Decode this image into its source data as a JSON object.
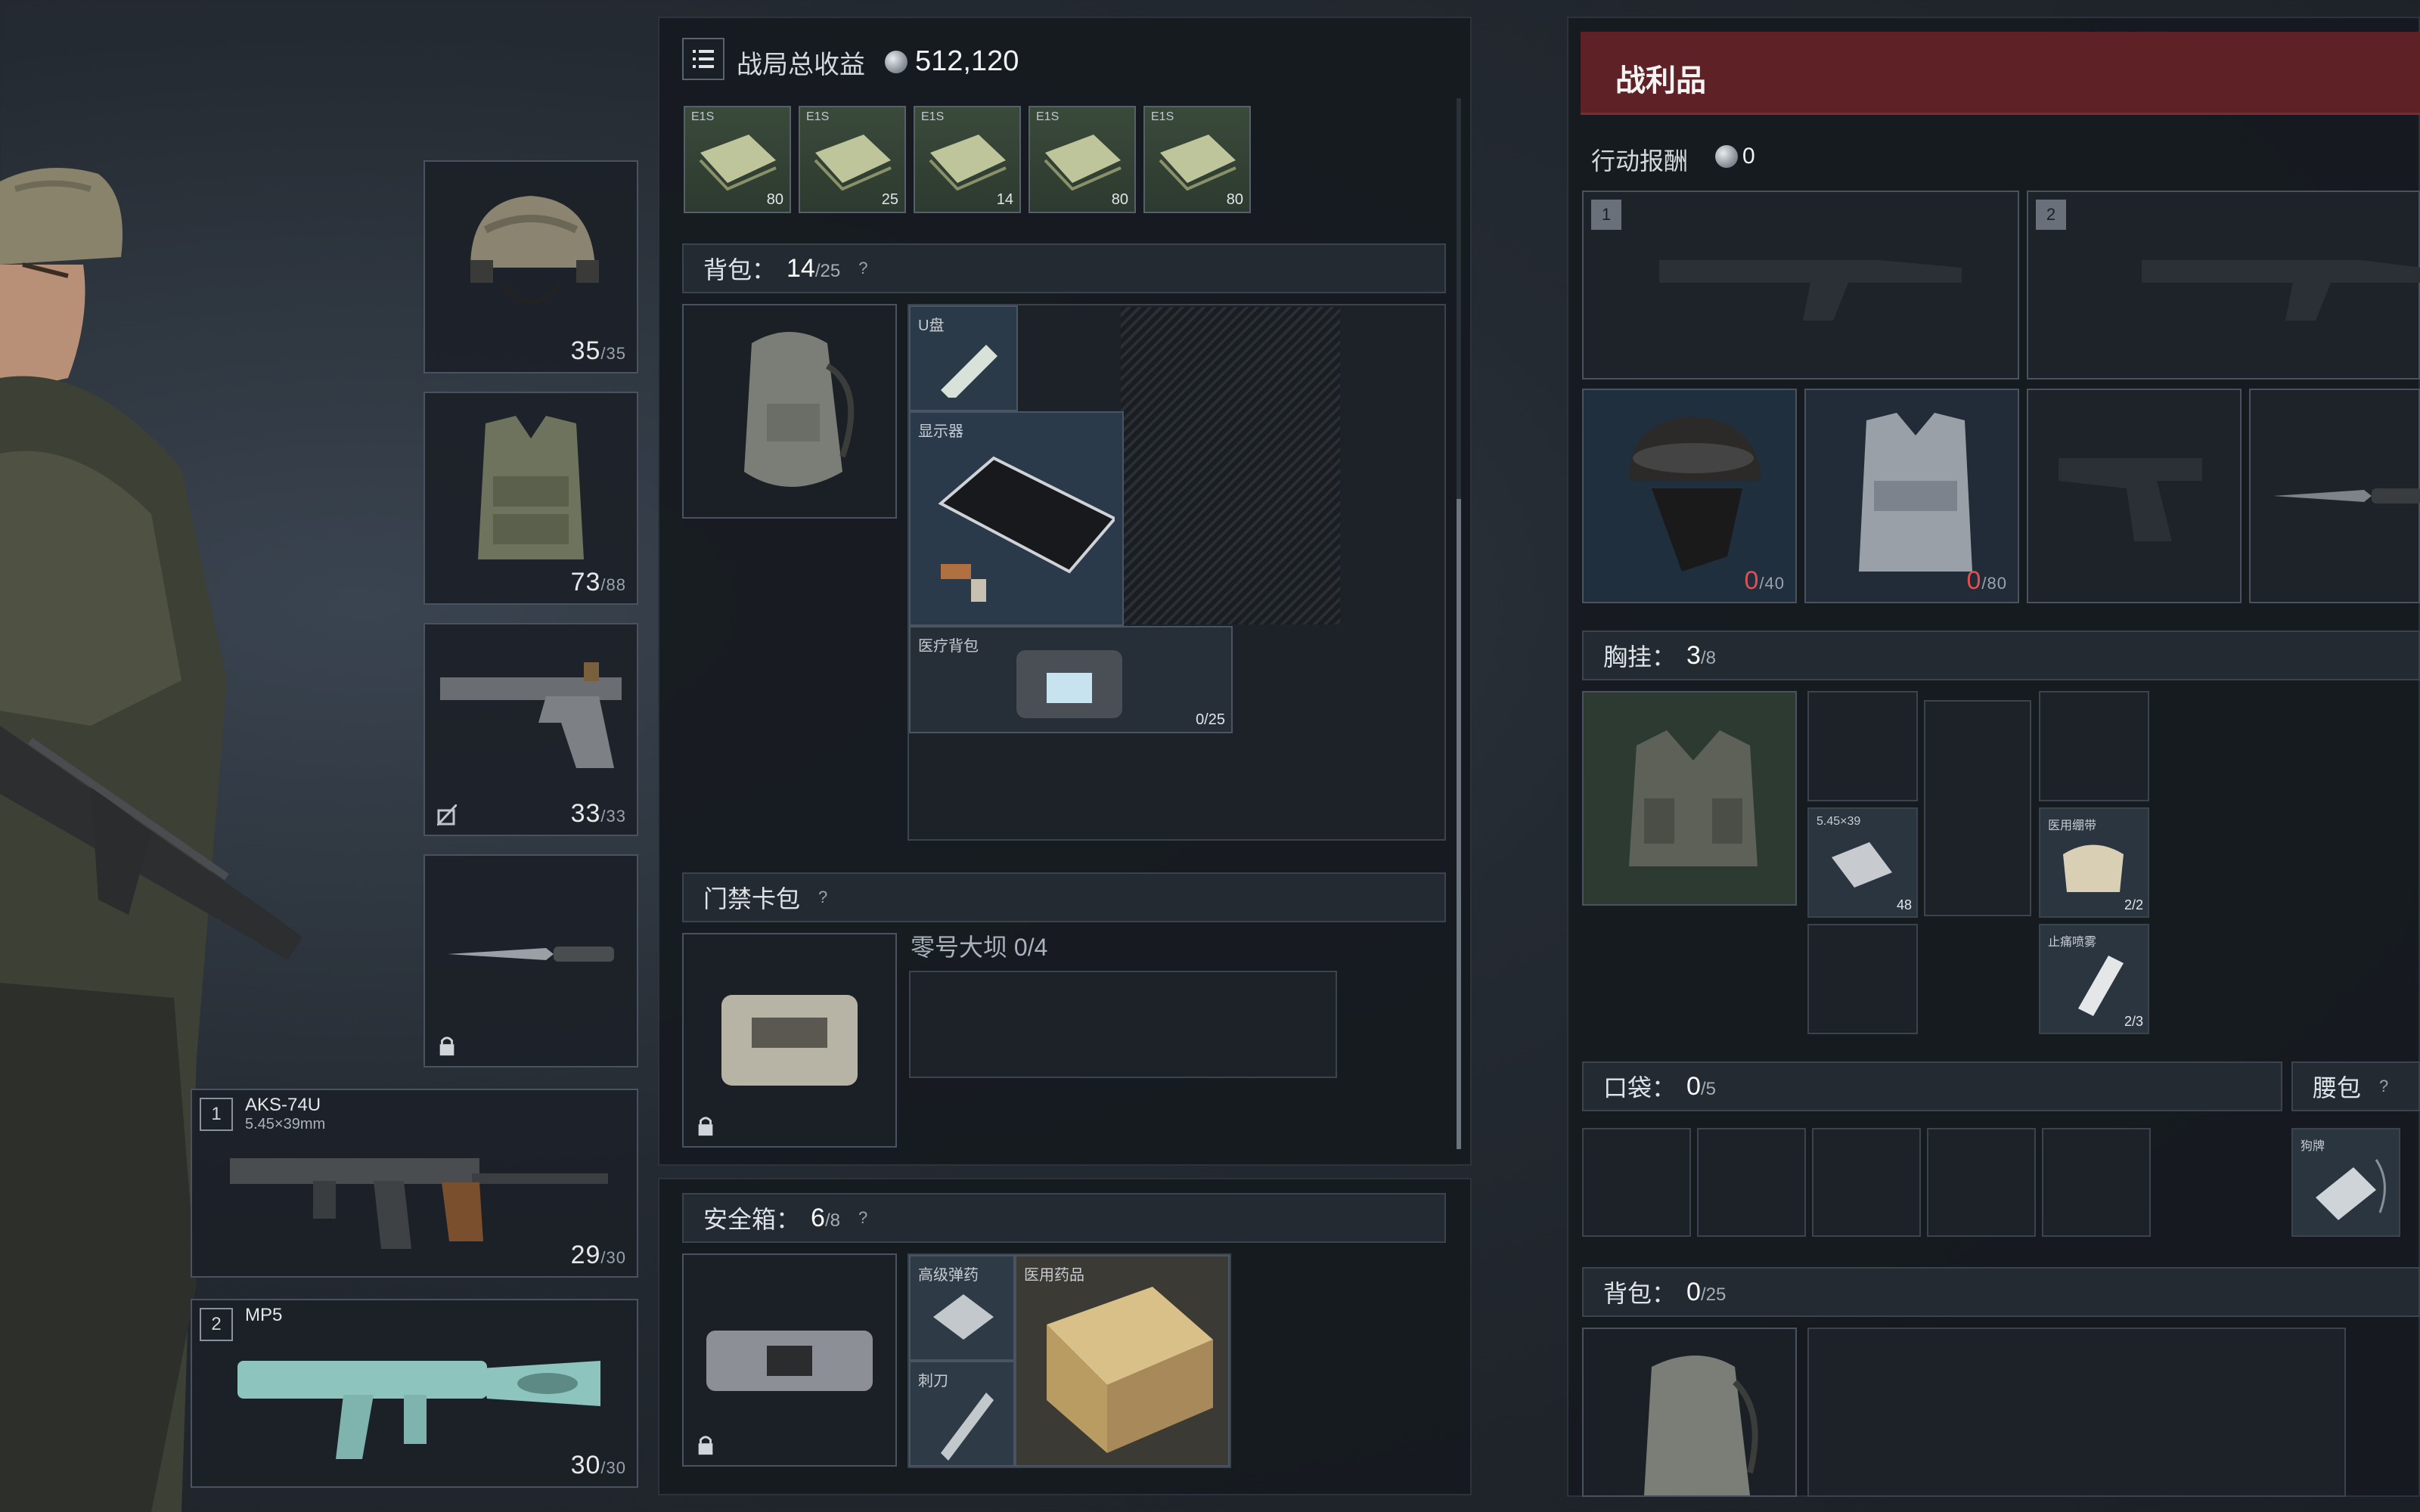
{
  "header": {
    "title": "战局总收益",
    "total_value": "512,120"
  },
  "reward_cards": [
    {
      "name": "E1S",
      "value": "80"
    },
    {
      "name": "E1S",
      "value": "25"
    },
    {
      "name": "E1S",
      "value": "14"
    },
    {
      "name": "E1S",
      "value": "80"
    },
    {
      "name": "E1S",
      "value": "80"
    }
  ],
  "left_slots": {
    "helmet": {
      "cur": "35",
      "max": "/35"
    },
    "armor": {
      "cur": "73",
      "max": "/88"
    },
    "pistol": {
      "cur": "33",
      "max": "/33"
    },
    "primary": {
      "index": "1",
      "name": "AKS-74U",
      "caliber": "5.45×39mm",
      "cur": "29",
      "max": "/30"
    },
    "secondary": {
      "index": "2",
      "name": "MP5",
      "cur": "30",
      "max": "/30"
    }
  },
  "backpack": {
    "label": "背包：",
    "count": "14",
    "capacity": "/25",
    "help": "?",
    "items": [
      {
        "label": "U盘",
        "value": ""
      },
      {
        "label": "显示器",
        "value": ""
      },
      {
        "label": "医疗背包",
        "value": "0/25"
      }
    ]
  },
  "keycard": {
    "label": "门禁卡包",
    "help": "?",
    "item_name": "零号大坝 0/4"
  },
  "safebox": {
    "label": "安全箱：",
    "count": "6",
    "capacity": "/8",
    "help": "?",
    "items": [
      {
        "label": "高级弹药"
      },
      {
        "label": "医用药品"
      },
      {
        "label": "刺刀"
      }
    ]
  },
  "loot": {
    "title": "战利品",
    "reward_label": "行动报酬",
    "reward_value": "0",
    "weapon_slots": [
      "1",
      "2"
    ],
    "helmet": {
      "cur": "0",
      "max": "/40"
    },
    "armor": {
      "cur": "0",
      "max": "/80"
    },
    "chest_rig": {
      "label": "胸挂：",
      "count": "3",
      "capacity": "/8"
    },
    "rig_items": [
      {
        "label": "5.45×39",
        "value": "48"
      },
      {
        "label": "医用绷带",
        "value": "2/2"
      },
      {
        "label": "止痛喷雾",
        "value": "2/3"
      }
    ],
    "pockets": {
      "label": "口袋：",
      "count": "0",
      "capacity": "/5"
    },
    "pouch": {
      "label": "腰包",
      "help": "?",
      "item": "狗牌"
    },
    "backpack": {
      "label": "背包：",
      "count": "0",
      "capacity": "/25"
    }
  },
  "colors": {
    "loot_header": "#6b2328",
    "panel_bg": "#1a1f25",
    "accent_green": "#3d5a45"
  }
}
